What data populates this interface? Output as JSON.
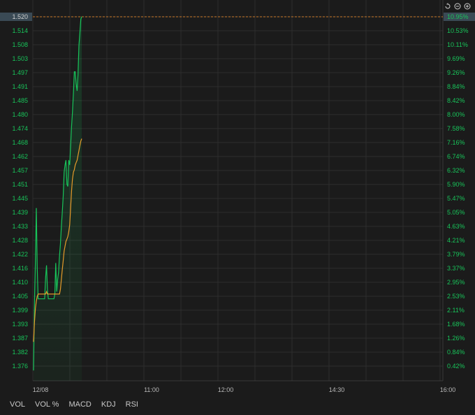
{
  "chart_data": {
    "type": "line",
    "y_left_ticks": [
      "1.520",
      "1.514",
      "1.508",
      "1.503",
      "1.497",
      "1.491",
      "1.485",
      "1.480",
      "1.474",
      "1.468",
      "1.462",
      "1.457",
      "1.451",
      "1.445",
      "1.439",
      "1.433",
      "1.428",
      "1.422",
      "1.416",
      "1.410",
      "1.405",
      "1.399",
      "1.393",
      "1.387",
      "1.382",
      "1.376"
    ],
    "y_right_ticks": [
      "10.95%",
      "10.53%",
      "10.11%",
      "9.69%",
      "9.26%",
      "8.84%",
      "8.42%",
      "8.00%",
      "7.58%",
      "7.16%",
      "6.74%",
      "6.32%",
      "5.90%",
      "5.47%",
      "5.05%",
      "4.63%",
      "4.21%",
      "3.79%",
      "3.37%",
      "2.95%",
      "2.53%",
      "2.11%",
      "1.68%",
      "1.26%",
      "0.84%",
      "0.42%"
    ],
    "ylim": [
      1.37,
      1.52
    ],
    "x_ticks": [
      "12/08",
      "11:00",
      "12:00",
      "14:30",
      "16:00"
    ],
    "current_price_label": "1.520",
    "current_pct_label": "10.95%",
    "series": [
      {
        "color": "#18c45a",
        "points": [
          [
            0,
            1.372
          ],
          [
            1,
            1.4
          ],
          [
            2,
            1.418
          ],
          [
            3,
            1.44
          ],
          [
            4,
            1.415
          ],
          [
            5,
            1.402
          ],
          [
            6,
            1.402
          ],
          [
            7,
            1.402
          ],
          [
            8,
            1.402
          ],
          [
            9,
            1.402
          ],
          [
            10,
            1.402
          ],
          [
            11,
            1.402
          ],
          [
            12,
            1.402
          ],
          [
            13,
            1.411
          ],
          [
            14,
            1.416
          ],
          [
            15,
            1.406
          ],
          [
            16,
            1.402
          ],
          [
            17,
            1.402
          ],
          [
            18,
            1.402
          ],
          [
            19,
            1.402
          ],
          [
            20,
            1.402
          ],
          [
            21,
            1.402
          ],
          [
            22,
            1.402
          ],
          [
            23,
            1.404
          ],
          [
            24,
            1.417
          ],
          [
            25,
            1.405
          ],
          [
            26,
            1.41
          ],
          [
            27,
            1.413
          ],
          [
            28,
            1.42
          ],
          [
            29,
            1.425
          ],
          [
            30,
            1.432
          ],
          [
            31,
            1.438
          ],
          [
            32,
            1.445
          ],
          [
            33,
            1.455
          ],
          [
            34,
            1.458
          ],
          [
            35,
            1.46
          ],
          [
            36,
            1.45
          ],
          [
            37,
            1.449
          ],
          [
            38,
            1.46
          ],
          [
            39,
            1.458
          ],
          [
            40,
            1.466
          ],
          [
            41,
            1.474
          ],
          [
            42,
            1.48
          ],
          [
            43,
            1.488
          ],
          [
            44,
            1.497
          ],
          [
            45,
            1.497
          ],
          [
            46,
            1.492
          ],
          [
            47,
            1.489
          ],
          [
            48,
            1.496
          ],
          [
            49,
            1.508
          ],
          [
            50,
            1.513
          ],
          [
            51,
            1.519
          ],
          [
            52,
            1.52
          ]
        ]
      },
      {
        "color": "#e69a2a",
        "points": [
          [
            0,
            1.384
          ],
          [
            1,
            1.392
          ],
          [
            2,
            1.398
          ],
          [
            3,
            1.401
          ],
          [
            4,
            1.403
          ],
          [
            5,
            1.404
          ],
          [
            6,
            1.404
          ],
          [
            7,
            1.404
          ],
          [
            8,
            1.404
          ],
          [
            9,
            1.404
          ],
          [
            10,
            1.404
          ],
          [
            11,
            1.404
          ],
          [
            12,
            1.404
          ],
          [
            13,
            1.404
          ],
          [
            14,
            1.405
          ],
          [
            15,
            1.404
          ],
          [
            16,
            1.404
          ],
          [
            17,
            1.404
          ],
          [
            18,
            1.404
          ],
          [
            19,
            1.404
          ],
          [
            20,
            1.404
          ],
          [
            21,
            1.404
          ],
          [
            22,
            1.404
          ],
          [
            23,
            1.404
          ],
          [
            24,
            1.404
          ],
          [
            25,
            1.404
          ],
          [
            26,
            1.404
          ],
          [
            27,
            1.404
          ],
          [
            28,
            1.404
          ],
          [
            29,
            1.406
          ],
          [
            30,
            1.41
          ],
          [
            31,
            1.414
          ],
          [
            32,
            1.418
          ],
          [
            33,
            1.422
          ],
          [
            34,
            1.424
          ],
          [
            35,
            1.426
          ],
          [
            36,
            1.427
          ],
          [
            37,
            1.428
          ],
          [
            38,
            1.43
          ],
          [
            39,
            1.433
          ],
          [
            40,
            1.44
          ],
          [
            41,
            1.447
          ],
          [
            42,
            1.452
          ],
          [
            43,
            1.455
          ],
          [
            44,
            1.456
          ],
          [
            45,
            1.458
          ],
          [
            46,
            1.459
          ],
          [
            47,
            1.46
          ],
          [
            48,
            1.462
          ],
          [
            49,
            1.464
          ],
          [
            50,
            1.466
          ],
          [
            51,
            1.468
          ],
          [
            52,
            1.469
          ]
        ]
      }
    ],
    "colors": {
      "up_text": "#18c45a",
      "tick_text": "#b8b8b8",
      "ref_line": "#c8782a",
      "grid": "#2e2e2e"
    }
  },
  "tabs": [
    "VOL",
    "VOL %",
    "MACD",
    "KDJ",
    "RSI"
  ],
  "toolbar_icons": [
    "reset-icon",
    "zoom-out-icon",
    "zoom-in-icon"
  ]
}
